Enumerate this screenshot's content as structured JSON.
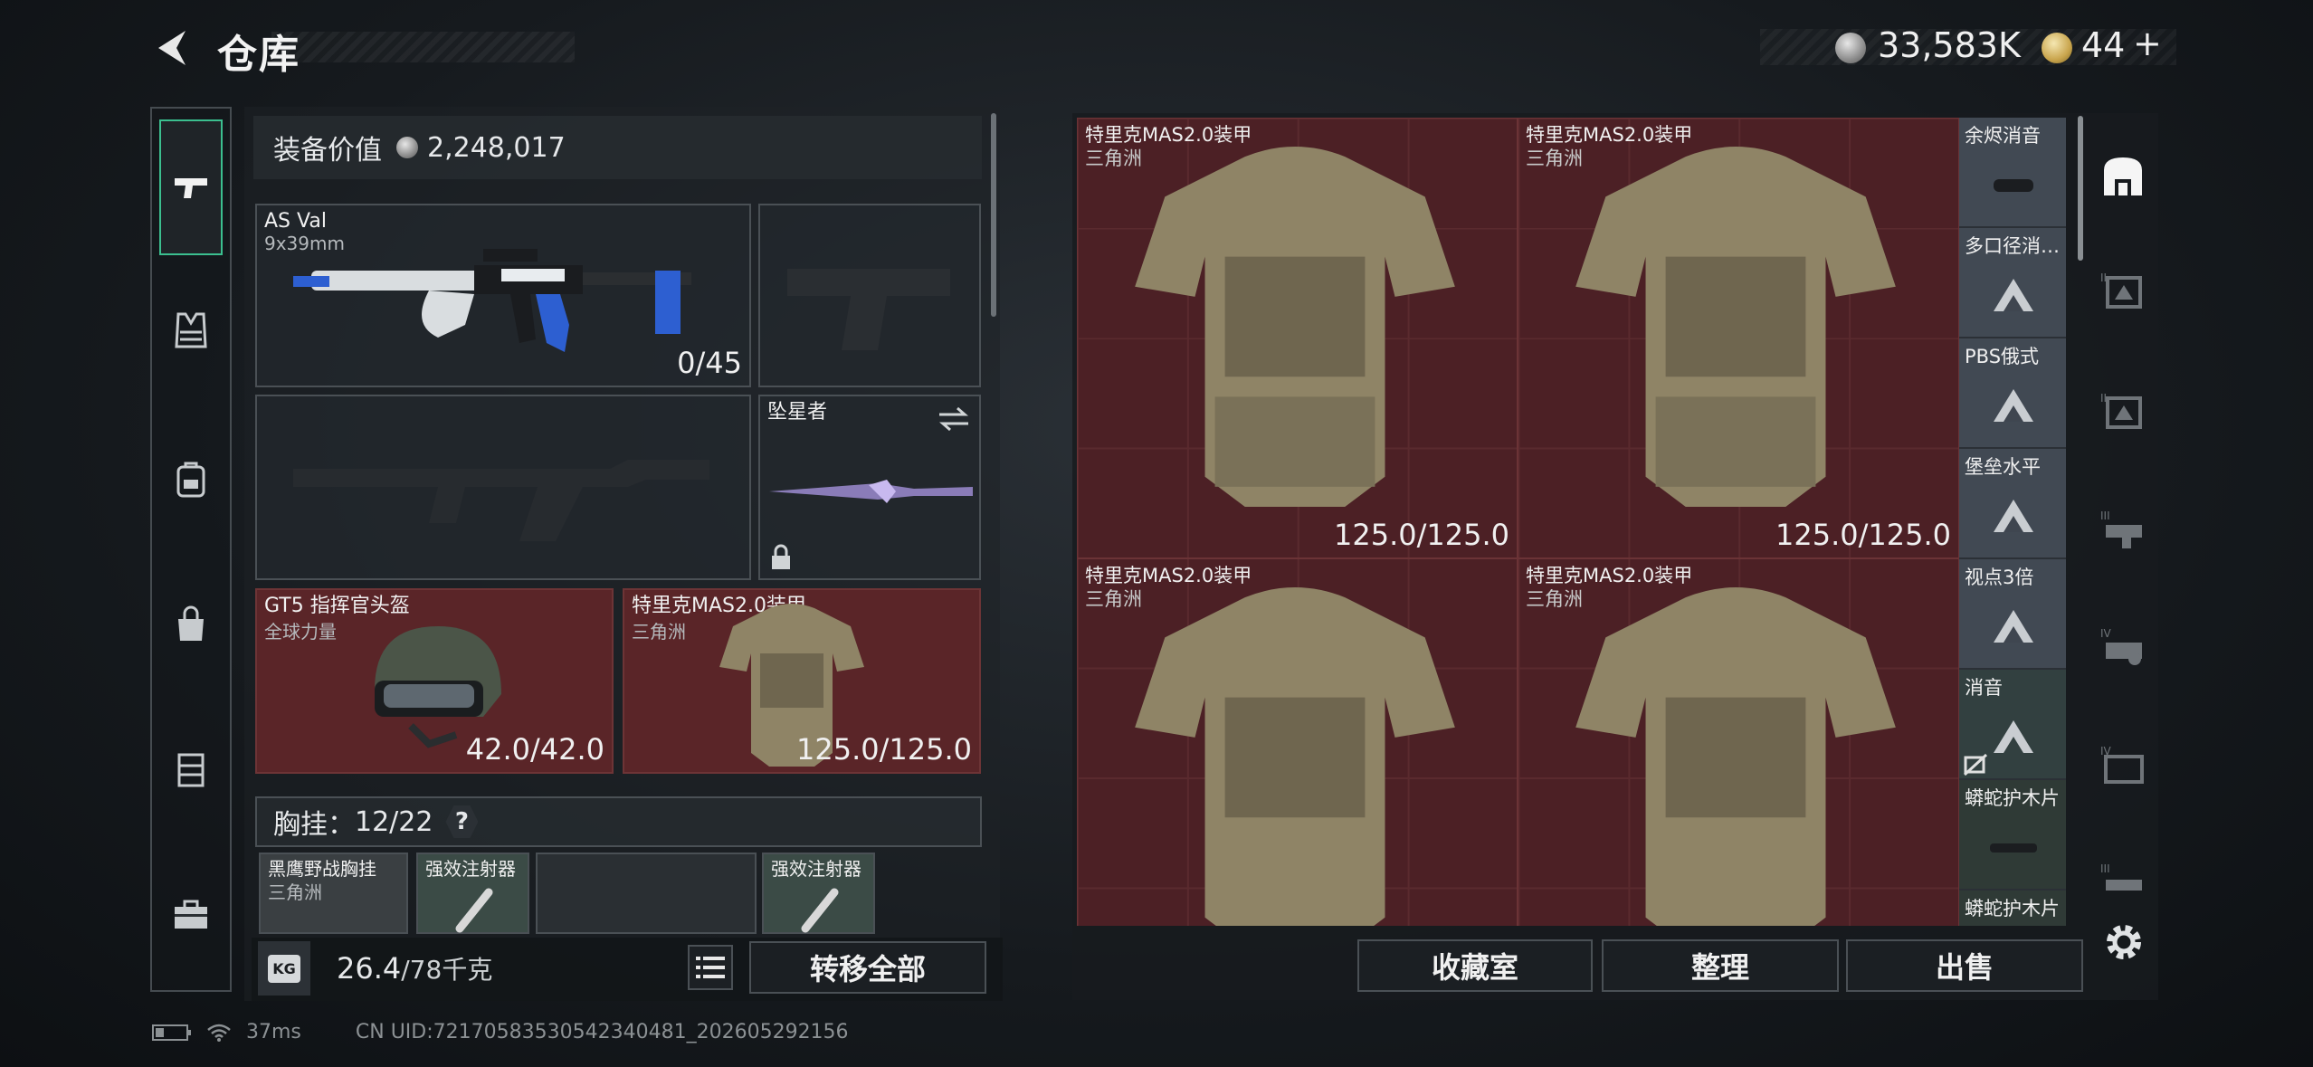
{
  "header": {
    "title": "仓库",
    "silver_amount": "33,583K",
    "gold_amount": "44",
    "gold_plus": "+"
  },
  "equip": {
    "value_label": "装备价值",
    "value": "2,248,017"
  },
  "slots": {
    "primary": {
      "name": "AS Val",
      "sub": "9x39mm",
      "ammo": "0/45"
    },
    "melee": {
      "name": "坠星者"
    },
    "helmet": {
      "name": "GT5 指挥官头盔",
      "sub": "全球力量",
      "durability": "42.0/42.0"
    },
    "armor": {
      "name": "特里克MAS2.0装甲",
      "sub": "三角洲",
      "durability": "125.0/125.0"
    }
  },
  "chest": {
    "label": "胸挂",
    "count": "12/22",
    "help": "?",
    "items": [
      {
        "name": "黑鹰野战胸挂",
        "sub": "三角洲"
      },
      {
        "name": "强效注射器",
        "sub": ""
      },
      {
        "name": "",
        "sub": ""
      },
      {
        "name": "强效注射器",
        "sub": ""
      }
    ]
  },
  "weight": {
    "current": "26.4",
    "max": "/78千克",
    "badge": "KG"
  },
  "buttons": {
    "transfer_all": "转移全部",
    "collection": "收藏室",
    "organize": "整理",
    "sell": "出售"
  },
  "storage": {
    "items": [
      {
        "name": "特里克MAS2.0装甲",
        "sub": "三角洲",
        "durability": "125.0/125.0"
      },
      {
        "name": "特里克MAS2.0装甲",
        "sub": "三角洲",
        "durability": "125.0/125.0"
      },
      {
        "name": "特里克MAS2.0装甲",
        "sub": "三角洲",
        "durability": ""
      },
      {
        "name": "特里克MAS2.0装甲",
        "sub": "三角洲",
        "durability": ""
      }
    ],
    "side_items": [
      {
        "label": "余烬消音",
        "icon": "suppressor-icon"
      },
      {
        "label": "多口径消…",
        "icon": "triangle-placeholder-icon"
      },
      {
        "label": "PBS俄式",
        "icon": "triangle-placeholder-icon"
      },
      {
        "label": "堡垒水平",
        "icon": "triangle-placeholder-icon"
      },
      {
        "label": "视点3倍",
        "icon": "triangle-placeholder-icon"
      },
      {
        "label": "消音",
        "icon": "triangle-placeholder-icon"
      },
      {
        "label": "蟒蛇护木片",
        "icon": "handguard-icon"
      },
      {
        "label": "蟒蛇护木片",
        "icon": "handguard-icon"
      }
    ]
  },
  "status": {
    "ping": "37ms",
    "uid": "CN UID:72170583530542340481_202605292156"
  },
  "colors": {
    "accent_green": "#3bbf8f",
    "slot_red": "#5a2528",
    "storage_red": "#4c2025"
  }
}
